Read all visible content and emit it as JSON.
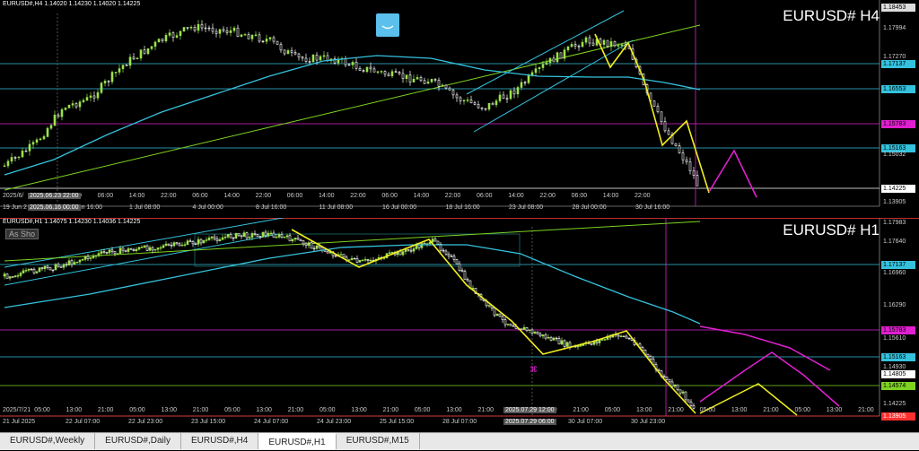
{
  "colors": {
    "bull": "#9be34a",
    "bear": "#ffffff",
    "ma": "#35c2dd",
    "trend": "#7ed321",
    "zigzag": "#f2ee20",
    "forecast": "#e020d0",
    "resist_line": "#35c2dd",
    "magenta_line": "#e020d0"
  },
  "h4": {
    "header": "EURUSD#,H4  1.14020 1.14230 1.14020 1.14225",
    "symbol": "EURUSD# H4",
    "axis_high": "1.18453",
    "price_labels": [
      {
        "text": "1.17994",
        "style": "plain"
      },
      {
        "text": "1.17270",
        "style": "plain"
      },
      {
        "text": "1.17137",
        "style": "cyan"
      },
      {
        "text": "1.16553",
        "style": "cyan"
      },
      {
        "text": "1.15783",
        "style": "magenta"
      },
      {
        "text": "1.15163",
        "style": "cyan"
      },
      {
        "text": "1.15032",
        "style": "plain"
      },
      {
        "text": "1.14225",
        "style": "white"
      },
      {
        "text": "1.13905",
        "style": "plain"
      }
    ],
    "time_labels": [
      "2025/6/",
      "14:00",
      "22:00",
      "06:00",
      "14:00",
      "22:00",
      "06:00",
      "14:00",
      "22:00",
      "06:00",
      "14:00",
      "22:00",
      "06:00",
      "14:00",
      "22:00",
      "06:00",
      "14:00",
      "22:00",
      "06:00",
      "14:00",
      "22:00"
    ],
    "date_labels": [
      "19 Jun 2",
      "26 Jun 16:00",
      "1 Jul 08:00",
      "4 Jul 00:00",
      "8 Jul 16:00",
      "11 Jul 08:00",
      "16 Jul 00:00",
      "18 Jul 16:00",
      "23 Jul 08:00",
      "28 Jul 00:00",
      "30 Jul 16:00"
    ],
    "cursor_time": "2025.06.23 22:00",
    "cursor_date": "2025.06.16 00:00"
  },
  "h1": {
    "header": "EURUSD#,H1  1.14075 1.14230 1.14036 1.14225",
    "symbol": "EURUSD# H1",
    "as_show": "As Sho",
    "price_labels": [
      {
        "text": "1.17983",
        "style": "plain"
      },
      {
        "text": "1.17640",
        "style": "plain"
      },
      {
        "text": "1.17137",
        "style": "cyan"
      },
      {
        "text": "1.16960",
        "style": "plain"
      },
      {
        "text": "1.16290",
        "style": "plain"
      },
      {
        "text": "1.15783",
        "style": "magenta"
      },
      {
        "text": "1.15610",
        "style": "plain"
      },
      {
        "text": "1.15163",
        "style": "cyan"
      },
      {
        "text": "1.14930",
        "style": "plain"
      },
      {
        "text": "1.14805",
        "style": "white"
      },
      {
        "text": "1.14574",
        "style": "green"
      },
      {
        "text": "1.14225",
        "style": "plain"
      },
      {
        "text": "1.13905",
        "style": "red"
      }
    ],
    "time_labels": [
      "2025/7/21",
      "05:00",
      "13:00",
      "21:00",
      "05:00",
      "13:00",
      "21:00",
      "05:00",
      "13:00",
      "21:00",
      "05:00",
      "13:00",
      "21:00",
      "05:00",
      "13:00",
      "21:00",
      "05:00",
      "13:00",
      "21:00",
      "05:00",
      "13:00",
      "21:00",
      "05:00",
      "13:00",
      "21:00",
      "05:00",
      "13:00",
      "21:00"
    ],
    "date_labels": [
      "21 Jul 2025",
      "22 Jul 07:00",
      "22 Jul 23:00",
      "23 Jul 15:00",
      "24 Jul 07:00",
      "24 Jul 23:00",
      "25 Jul 15:00",
      "28 Jul 07:00",
      "29 Jul 15:00",
      "30 Jul 07:00",
      "30 Jul 23:00"
    ],
    "cursor_time": "2025.07.29 12:00",
    "cursor_date": "2025.07.29 06:00"
  },
  "tabs": [
    "EURUSD#,Weekly",
    "EURUSD#,Daily",
    "EURUSD#,H4",
    "EURUSD#,H1",
    "EURUSD#,M15"
  ],
  "active_tab": 3
}
